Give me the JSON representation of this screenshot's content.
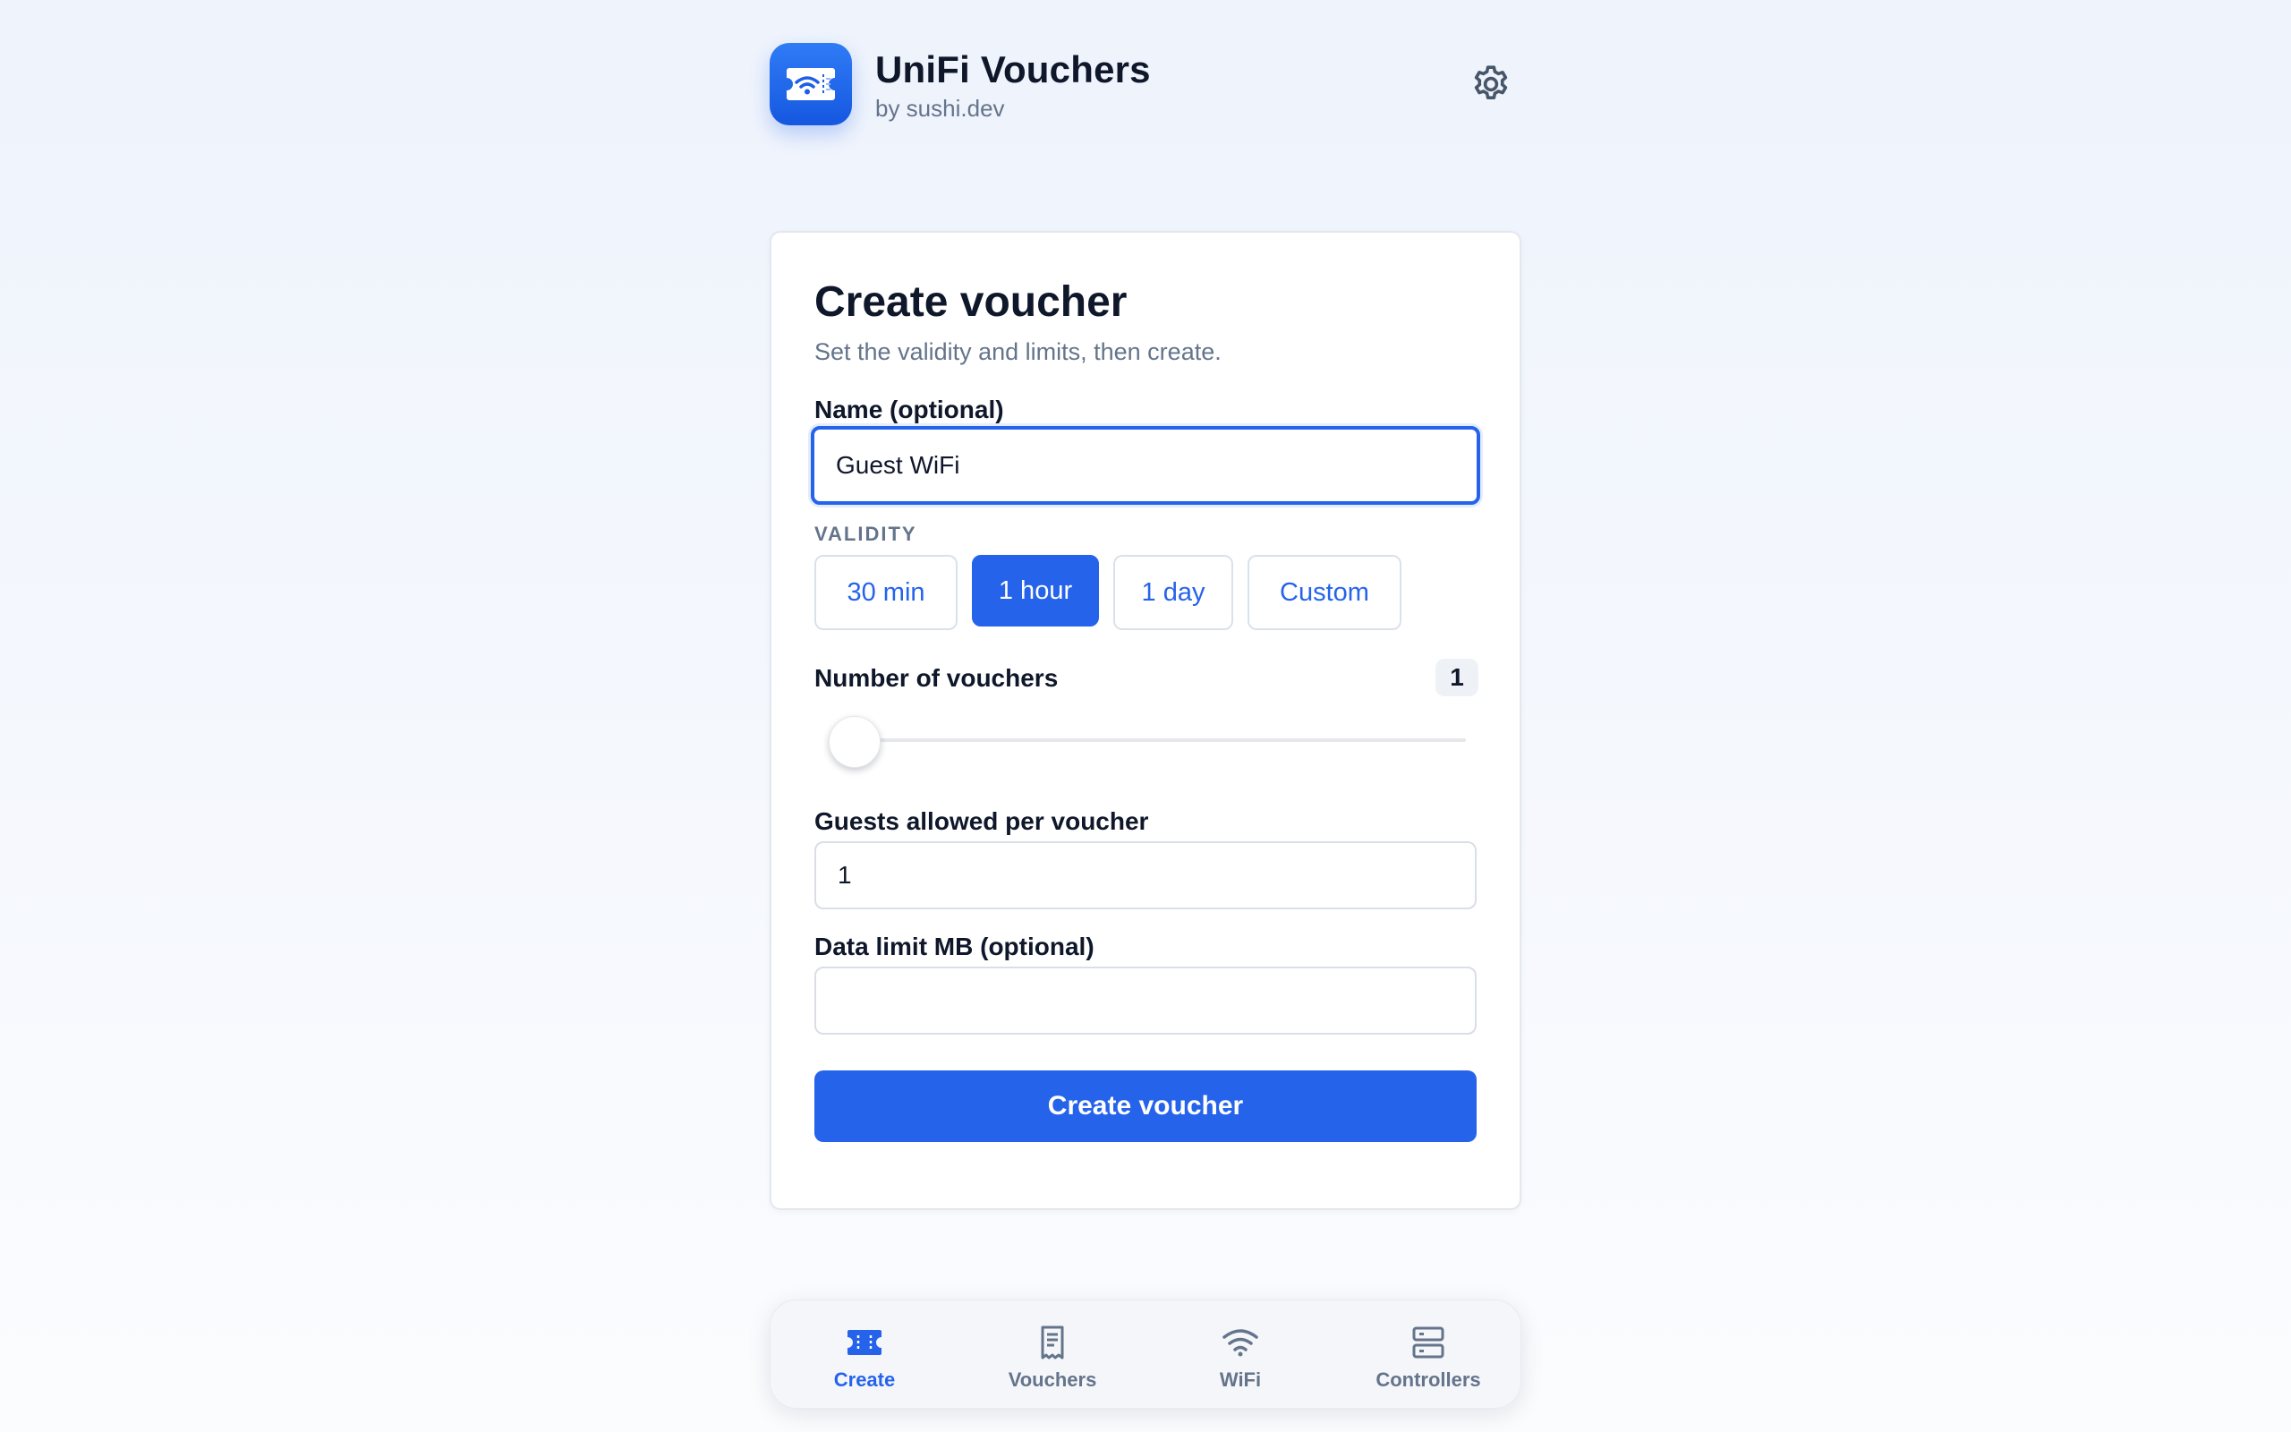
{
  "header": {
    "title": "UniFi Vouchers",
    "subtitle": "by sushi.dev",
    "app_icon": "wifi-ticket-icon",
    "settings_icon": "gear-icon"
  },
  "card": {
    "title": "Create voucher",
    "subtitle": "Set the validity and limits, then create.",
    "name_field": {
      "label": "Name (optional)",
      "value": "Guest WiFi"
    },
    "validity": {
      "label": "VALIDITY",
      "options": [
        {
          "label": "30 min",
          "selected": false
        },
        {
          "label": "1 hour",
          "selected": true
        },
        {
          "label": "1 day",
          "selected": false
        },
        {
          "label": "Custom",
          "selected": false
        }
      ]
    },
    "vouchers_count": {
      "label": "Number of vouchers",
      "value": "1",
      "slider_fraction": 0
    },
    "guests_field": {
      "label": "Guests allowed per voucher",
      "value": "1"
    },
    "data_limit_field": {
      "label": "Data limit MB (optional)",
      "value": ""
    },
    "submit_label": "Create voucher"
  },
  "bottom_nav": {
    "items": [
      {
        "label": "Create",
        "icon": "ticket-icon",
        "active": true
      },
      {
        "label": "Vouchers",
        "icon": "receipt-icon",
        "active": false
      },
      {
        "label": "WiFi",
        "icon": "wifi-icon",
        "active": false
      },
      {
        "label": "Controllers",
        "icon": "server-icon",
        "active": false
      }
    ]
  },
  "colors": {
    "accent": "#2563eb",
    "muted_text": "#64748b",
    "heading_text": "#0f172a"
  }
}
